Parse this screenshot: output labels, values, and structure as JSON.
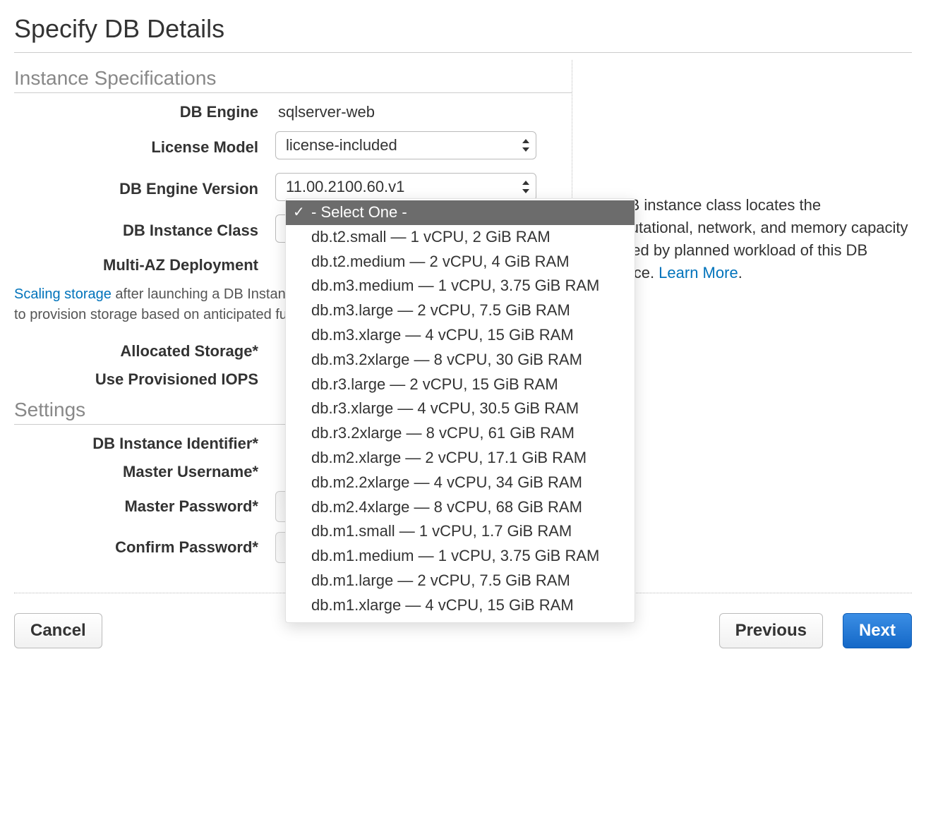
{
  "page": {
    "title": "Specify DB Details"
  },
  "sections": {
    "instance_spec": "Instance Specifications",
    "settings": "Settings"
  },
  "labels": {
    "db_engine": "DB Engine",
    "license_model": "License Model",
    "db_engine_version": "DB Engine Version",
    "db_instance_class": "DB Instance Class",
    "multi_az": "Multi-AZ Deployment",
    "allocated_storage": "Allocated Storage*",
    "provisioned_iops": "Use Provisioned IOPS",
    "db_instance_identifier": "DB Instance Identifier*",
    "master_username": "Master Username*",
    "master_password": "Master Password*",
    "confirm_password": "Confirm Password*"
  },
  "values": {
    "db_engine": "sqlserver-web",
    "license_model": "license-included",
    "db_engine_version": "11.00.2100.60.v1",
    "db_instance_class_selected": "- Select One -"
  },
  "note": {
    "link_text": "Scaling storage",
    "text_after": " after launching a DB Instance for Microsoft SQL Server. You may want to provision storage based on anticipated future storage growth."
  },
  "help": {
    "text_before": " the DB instance class locates the computational, network, and memory capacity required by planned workload of this DB instance. ",
    "learn_more": "Learn More",
    "period": "."
  },
  "instance_class_options": [
    "- Select One -",
    "db.t2.small — 1 vCPU, 2 GiB RAM",
    "db.t2.medium — 2 vCPU, 4 GiB RAM",
    "db.m3.medium — 1 vCPU, 3.75 GiB RAM",
    "db.m3.large — 2 vCPU, 7.5 GiB RAM",
    "db.m3.xlarge — 4 vCPU, 15 GiB RAM",
    "db.m3.2xlarge — 8 vCPU, 30 GiB RAM",
    "db.r3.large — 2 vCPU, 15 GiB RAM",
    "db.r3.xlarge — 4 vCPU, 30.5 GiB RAM",
    "db.r3.2xlarge — 8 vCPU, 61 GiB RAM",
    "db.m2.xlarge — 2 vCPU, 17.1 GiB RAM",
    "db.m2.2xlarge — 4 vCPU, 34 GiB RAM",
    "db.m2.4xlarge — 8 vCPU, 68 GiB RAM",
    "db.m1.small — 1 vCPU, 1.7 GiB RAM",
    "db.m1.medium — 1 vCPU, 3.75 GiB RAM",
    "db.m1.large — 2 vCPU, 7.5 GiB RAM",
    "db.m1.xlarge — 4 vCPU, 15 GiB RAM"
  ],
  "buttons": {
    "cancel": "Cancel",
    "previous": "Previous",
    "next": "Next"
  }
}
